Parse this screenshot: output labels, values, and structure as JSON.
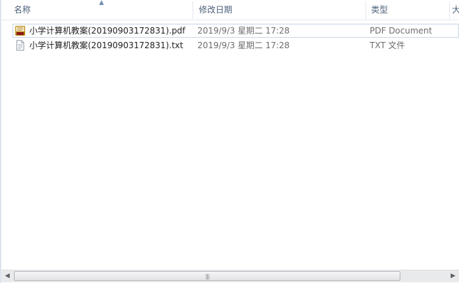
{
  "columns": {
    "name": "名称",
    "date_modified": "修改日期",
    "type": "类型",
    "size_partial": "大"
  },
  "sort": {
    "column": "name",
    "direction": "ascending",
    "icon": "sort-up-icon"
  },
  "files": [
    {
      "name": "小学计算机教案(20190903172831).pdf",
      "date": "2019/9/3 星期二 17:28",
      "type": "PDF Document",
      "icon": "pdf-file-icon",
      "focused": true
    },
    {
      "name": "小学计算机教案(20190903172831).txt",
      "date": "2019/9/3 星期二 17:28",
      "type": "TXT 文件",
      "icon": "text-file-icon",
      "focused": false
    }
  ],
  "scrollbar": {
    "left_arrow": "◀",
    "right_arrow": "▶",
    "grip": "|||"
  },
  "colors": {
    "header_text": "#4c607a",
    "meta_text": "#6d6d6d",
    "focus_border": "#c8d6e8"
  }
}
